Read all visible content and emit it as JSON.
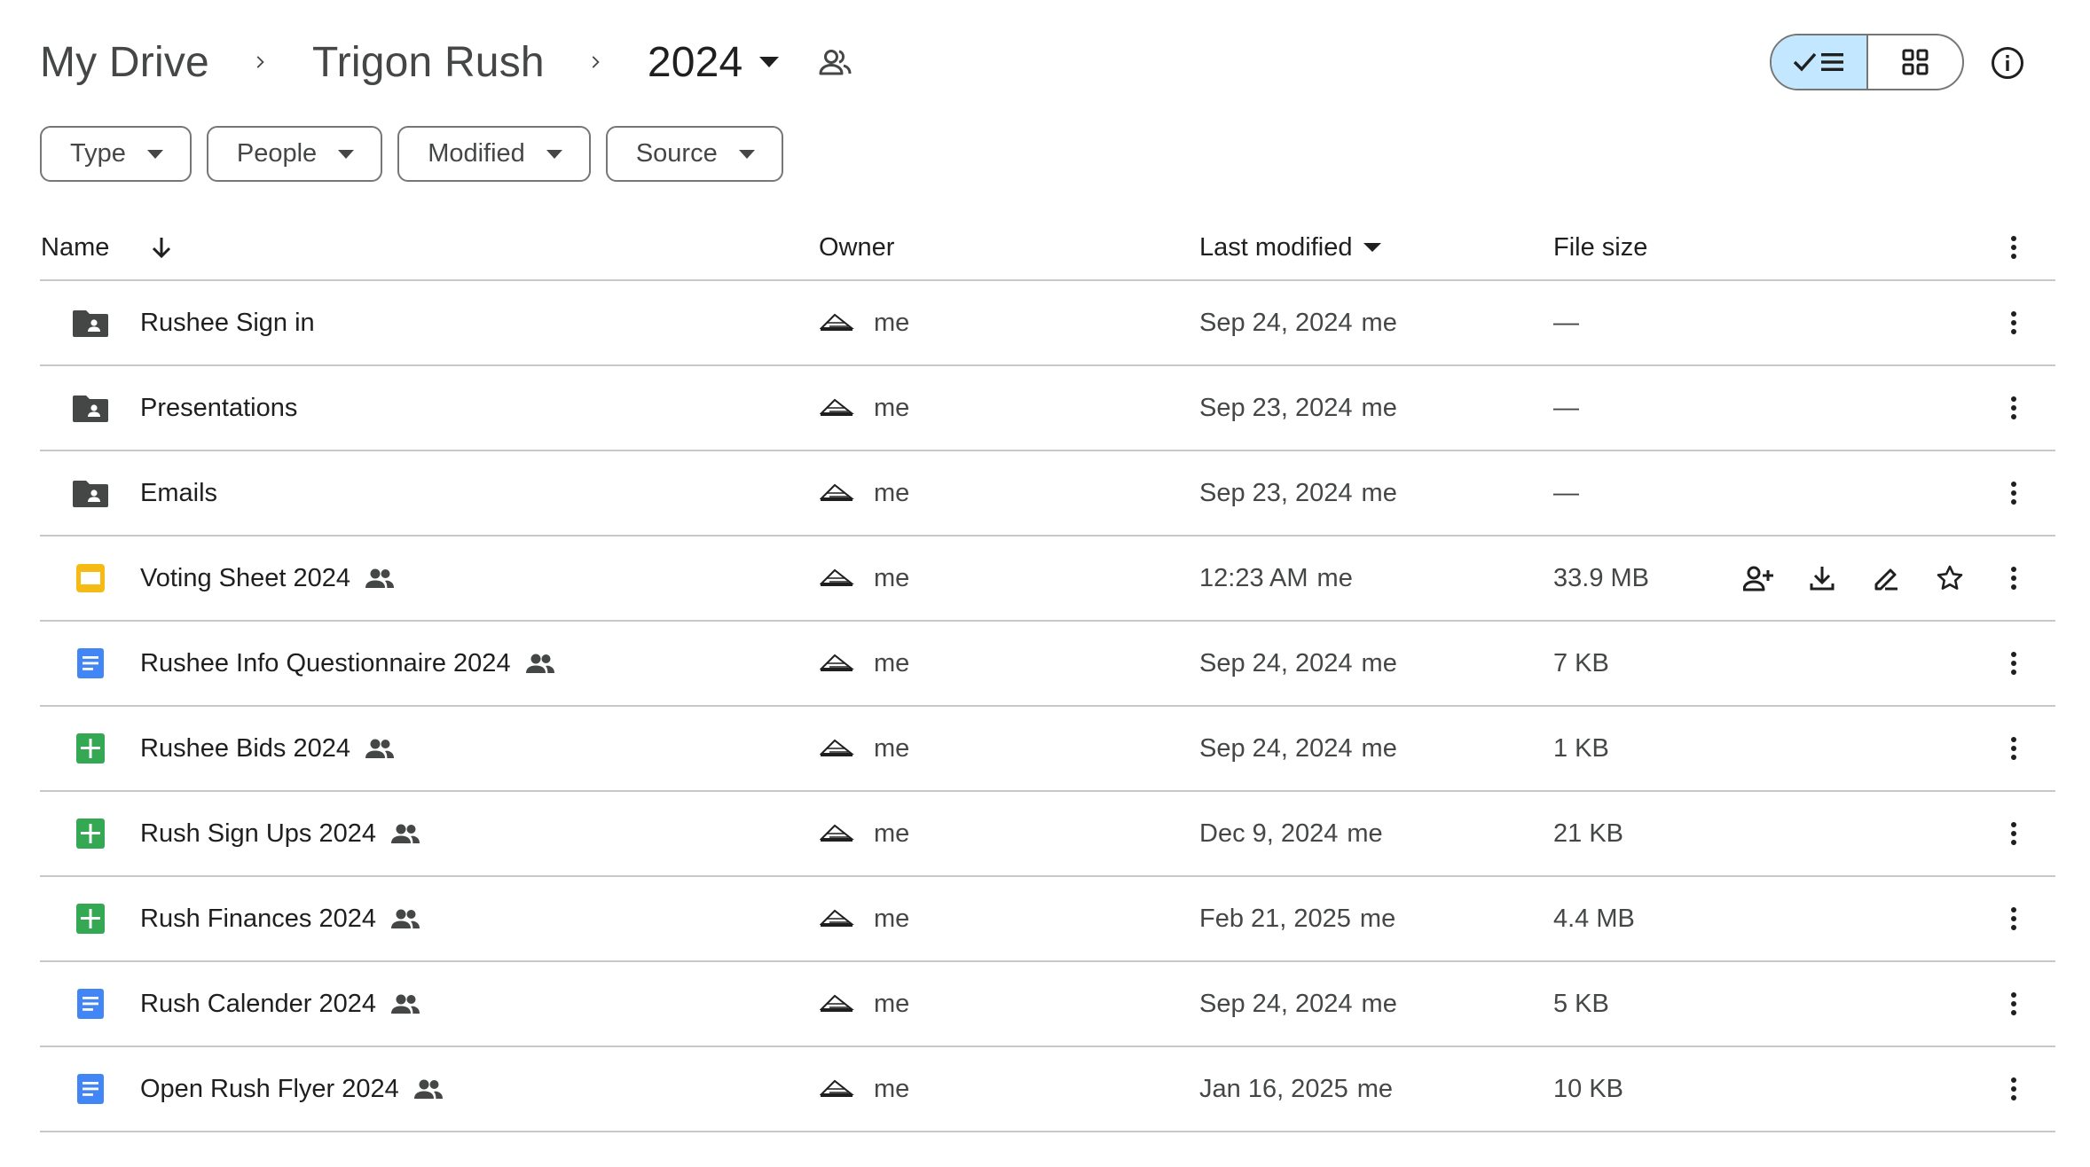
{
  "breadcrumb": {
    "items": [
      "My Drive",
      "Trigon Rush"
    ],
    "current": "2024"
  },
  "filters": [
    "Type",
    "People",
    "Modified",
    "Source"
  ],
  "columns": {
    "name": "Name",
    "owner": "Owner",
    "last_modified": "Last modified",
    "file_size": "File size"
  },
  "files": [
    {
      "name": "Rushee Sign in",
      "type": "shared-folder",
      "shared": false,
      "owner": "me",
      "modified": "Sep 24, 2024",
      "modified_by": "me",
      "size": "—"
    },
    {
      "name": "Presentations",
      "type": "shared-folder",
      "shared": false,
      "owner": "me",
      "modified": "Sep 23, 2024",
      "modified_by": "me",
      "size": "—"
    },
    {
      "name": "Emails",
      "type": "shared-folder",
      "shared": false,
      "owner": "me",
      "modified": "Sep 23, 2024",
      "modified_by": "me",
      "size": "—"
    },
    {
      "name": "Voting Sheet 2024",
      "type": "slides",
      "shared": true,
      "owner": "me",
      "modified": "12:23 AM",
      "modified_by": "me",
      "size": "33.9 MB",
      "hover": true
    },
    {
      "name": "Rushee Info Questionnaire 2024",
      "type": "doc",
      "shared": true,
      "owner": "me",
      "modified": "Sep 24, 2024",
      "modified_by": "me",
      "size": "7 KB"
    },
    {
      "name": "Rushee Bids 2024",
      "type": "sheet",
      "shared": true,
      "owner": "me",
      "modified": "Sep 24, 2024",
      "modified_by": "me",
      "size": "1 KB"
    },
    {
      "name": "Rush Sign Ups 2024",
      "type": "sheet",
      "shared": true,
      "owner": "me",
      "modified": "Dec 9, 2024",
      "modified_by": "me",
      "size": "21 KB"
    },
    {
      "name": "Rush Finances 2024",
      "type": "sheet",
      "shared": true,
      "owner": "me",
      "modified": "Feb 21, 2025",
      "modified_by": "me",
      "size": "4.4 MB"
    },
    {
      "name": "Rush Calender 2024",
      "type": "doc",
      "shared": true,
      "owner": "me",
      "modified": "Sep 24, 2024",
      "modified_by": "me",
      "size": "5 KB"
    },
    {
      "name": "Open Rush Flyer 2024",
      "type": "doc",
      "shared": true,
      "owner": "me",
      "modified": "Jan 16, 2025",
      "modified_by": "me",
      "size": "10 KB"
    }
  ],
  "row_actions": [
    "add-person-icon",
    "download-icon",
    "rename-icon",
    "star-icon"
  ],
  "colors": {
    "folder": "#444746",
    "slides": "#f5ba14",
    "doc": "#4285f4",
    "sheet": "#34a853",
    "toggle_active": "#c2e7ff",
    "divider": "#c7c7c7"
  }
}
